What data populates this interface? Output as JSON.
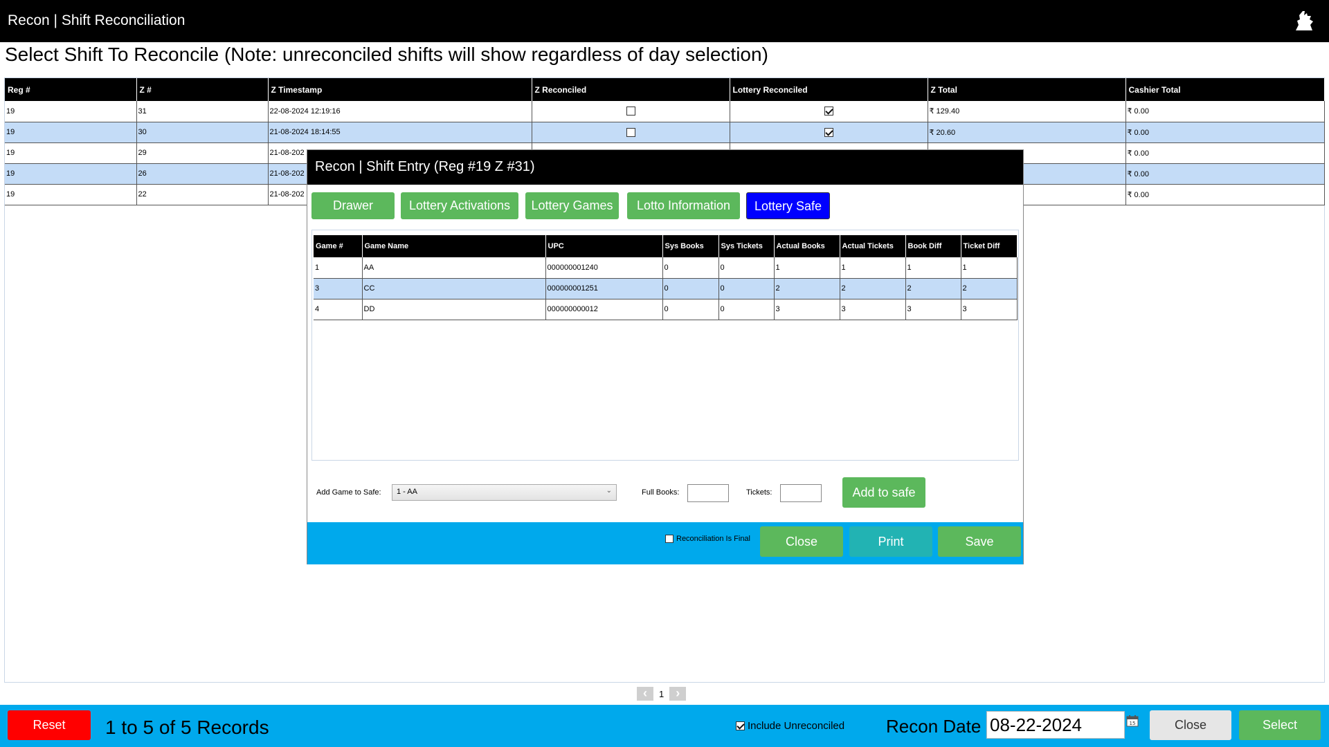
{
  "window": {
    "title": "Recon | Shift Reconciliation"
  },
  "heading": "Select Shift To Reconcile (Note: unreconciled shifts will show regardless of day selection)",
  "shifts": {
    "columns": [
      "Reg #",
      "Z #",
      "Z Timestamp",
      "Z Reconciled",
      "Lottery Reconciled",
      "Z Total",
      "Cashier Total"
    ],
    "rows": [
      {
        "reg": "19",
        "z": "31",
        "timestamp": "22-08-2024 12:19:16",
        "z_reconciled": false,
        "lottery_reconciled": true,
        "z_total": "₹ 129.40",
        "cashier_total": "₹ 0.00"
      },
      {
        "reg": "19",
        "z": "30",
        "timestamp": "21-08-2024 18:14:55",
        "z_reconciled": false,
        "lottery_reconciled": true,
        "z_total": "₹ 20.60",
        "cashier_total": "₹ 0.00"
      },
      {
        "reg": "19",
        "z": "29",
        "timestamp": "21-08-202",
        "z_reconciled": null,
        "lottery_reconciled": null,
        "z_total": "",
        "cashier_total": "₹ 0.00"
      },
      {
        "reg": "19",
        "z": "26",
        "timestamp": "21-08-202",
        "z_reconciled": null,
        "lottery_reconciled": null,
        "z_total": "",
        "cashier_total": "₹ 0.00"
      },
      {
        "reg": "19",
        "z": "22",
        "timestamp": "21-08-202",
        "z_reconciled": null,
        "lottery_reconciled": null,
        "z_total": "",
        "cashier_total": "₹ 0.00"
      }
    ]
  },
  "pager": {
    "page": "1"
  },
  "bottom": {
    "reset_label": "Reset",
    "records_text": "1 to 5 of 5 Records",
    "include_unreconciled_label": "Include Unreconciled",
    "include_unreconciled_checked": true,
    "recon_date_label": "Recon Date :",
    "recon_date_value": "08-22-2024",
    "close_label": "Close",
    "select_label": "Select"
  },
  "modal": {
    "title": "Recon | Shift Entry  (Reg #19  Z #31)",
    "tabs": [
      {
        "label": "Drawer",
        "active": false
      },
      {
        "label": "Lottery Activations",
        "active": false
      },
      {
        "label": "Lottery Games",
        "active": false
      },
      {
        "label": "Lotto Information",
        "active": false
      },
      {
        "label": "Lottery Safe",
        "active": true
      }
    ],
    "safe_table": {
      "columns": [
        "Game #",
        "Game Name",
        "UPC",
        "Sys Books",
        "Sys Tickets",
        "Actual Books",
        "Actual Tickets",
        "Book Diff",
        "Ticket Diff"
      ],
      "rows": [
        [
          "1",
          "AA",
          "000000001240",
          "0",
          "0",
          "1",
          "1",
          "1",
          "1"
        ],
        [
          "3",
          "CC",
          "000000001251",
          "0",
          "0",
          "2",
          "2",
          "2",
          "2"
        ],
        [
          "4",
          "DD",
          "000000000012",
          "0",
          "0",
          "3",
          "3",
          "3",
          "3"
        ]
      ]
    },
    "form": {
      "add_game_label": "Add Game to Safe:",
      "game_selected": "1 - AA",
      "full_books_label": "Full Books:",
      "tickets_label": "Tickets:",
      "add_button": "Add to safe"
    },
    "footer": {
      "final_label": "Reconciliation Is Final",
      "close_label": "Close",
      "print_label": "Print",
      "save_label": "Save"
    }
  },
  "colors": {
    "accent_blue": "#00a9ec",
    "green": "#5cb85c",
    "reset_red": "#ff0000",
    "active_tab": "#0000ff",
    "row_alt": "#c4dcf7"
  }
}
